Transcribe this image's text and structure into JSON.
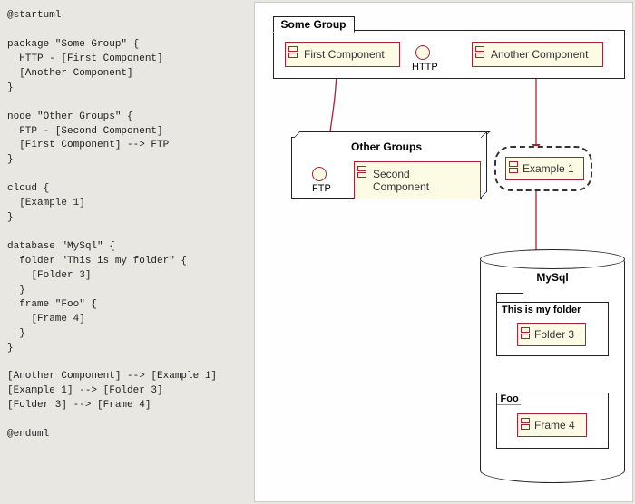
{
  "code": "@startuml\n\npackage \"Some Group\" {\n  HTTP - [First Component]\n  [Another Component]\n}\n\nnode \"Other Groups\" {\n  FTP - [Second Component]\n  [First Component] --> FTP\n}\n\ncloud {\n  [Example 1]\n}\n\ndatabase \"MySql\" {\n  folder \"This is my folder\" {\n    [Folder 3]\n  }\n  frame \"Foo\" {\n    [Frame 4]\n  }\n}\n\n[Another Component] --> [Example 1]\n[Example 1] --> [Folder 3]\n[Folder 3] --> [Frame 4]\n\n@enduml",
  "diagram": {
    "someGroup": {
      "title": "Some Group"
    },
    "otherGroups": {
      "title": "Other Groups"
    },
    "mysql": {
      "title": "MySql"
    },
    "folder": {
      "title": "This is my folder"
    },
    "frame": {
      "title": "Foo"
    },
    "components": {
      "first": "First Component",
      "another": "Another Component",
      "second": "Second Component",
      "example1": "Example 1",
      "folder3": "Folder 3",
      "frame4": "Frame 4"
    },
    "interfaces": {
      "http": "HTTP",
      "ftp": "FTP"
    }
  },
  "chart_data": {
    "type": "component-diagram",
    "language": "PlantUML",
    "containers": [
      {
        "id": "some-group",
        "kind": "package",
        "label": "Some Group",
        "children": [
          "first-component",
          "another-component",
          "http"
        ]
      },
      {
        "id": "other-groups",
        "kind": "node",
        "label": "Other Groups",
        "children": [
          "second-component",
          "ftp"
        ]
      },
      {
        "id": "cloud",
        "kind": "cloud",
        "label": "",
        "children": [
          "example-1"
        ]
      },
      {
        "id": "mysql",
        "kind": "database",
        "label": "MySql",
        "children": [
          "folder",
          "foo"
        ]
      },
      {
        "id": "folder",
        "kind": "folder",
        "label": "This is my folder",
        "children": [
          "folder-3"
        ]
      },
      {
        "id": "foo",
        "kind": "frame",
        "label": "Foo",
        "children": [
          "frame-4"
        ]
      }
    ],
    "components": [
      {
        "id": "first-component",
        "label": "First Component"
      },
      {
        "id": "another-component",
        "label": "Another Component"
      },
      {
        "id": "second-component",
        "label": "Second Component"
      },
      {
        "id": "example-1",
        "label": "Example 1"
      },
      {
        "id": "folder-3",
        "label": "Folder 3"
      },
      {
        "id": "frame-4",
        "label": "Frame 4"
      }
    ],
    "interfaces": [
      {
        "id": "http",
        "label": "HTTP"
      },
      {
        "id": "ftp",
        "label": "FTP"
      }
    ],
    "edges": [
      {
        "from": "http",
        "to": "first-component",
        "style": "line"
      },
      {
        "from": "ftp",
        "to": "second-component",
        "style": "line"
      },
      {
        "from": "first-component",
        "to": "ftp",
        "style": "arrow-dashed"
      },
      {
        "from": "another-component",
        "to": "example-1",
        "style": "arrow-dashed"
      },
      {
        "from": "example-1",
        "to": "folder-3",
        "style": "arrow-dashed"
      },
      {
        "from": "folder-3",
        "to": "frame-4",
        "style": "arrow-dashed"
      }
    ]
  }
}
